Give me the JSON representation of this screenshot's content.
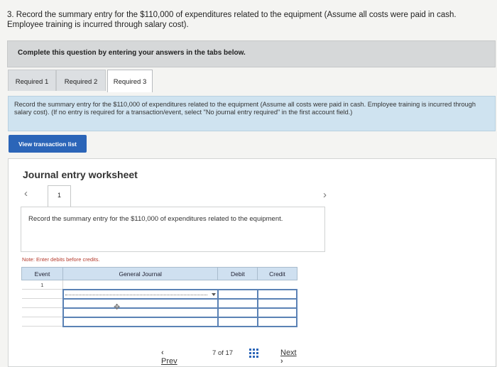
{
  "question": {
    "text": "3. Record the summary entry for the $110,000 of expenditures related to the equipment (Assume all costs were paid in cash. Employee training is incurred through salary cost)."
  },
  "instructions": "Complete this question by entering your answers in the tabs below.",
  "tabs": [
    {
      "label": "Required 1"
    },
    {
      "label": "Required 2"
    },
    {
      "label": "Required 3"
    }
  ],
  "requirement_text": "Record the summary entry for the $110,000 of expenditures related to the equipment (Assume all costs were paid in cash. Employee training is incurred through salary cost). (If no entry is required for a transaction/event, select \"No journal entry required\" in the first account field.)",
  "view_button": "View transaction list",
  "worksheet": {
    "title": "Journal entry worksheet",
    "entry_tab": "1",
    "description": "Record the summary entry for the $110,000 of expenditures related to the equipment.",
    "note": "Note: Enter debits before credits.",
    "columns": {
      "event": "Event",
      "general_journal": "General Journal",
      "debit": "Debit",
      "credit": "Credit"
    },
    "rows": [
      {
        "event": "1"
      }
    ]
  },
  "pager": {
    "prev": "Prev",
    "page": "7",
    "of": "of",
    "total": "17",
    "next": "Next"
  },
  "icons": [
    "chevron-left-icon",
    "chevron-right-icon",
    "dropdown-arrow-icon",
    "move-cursor-icon",
    "grid-icon"
  ],
  "colors": {
    "accent": "#2b65b8",
    "note": "#b53b2d",
    "header_bg": "#cfe0f0",
    "req_bg": "#cfe3f0"
  }
}
